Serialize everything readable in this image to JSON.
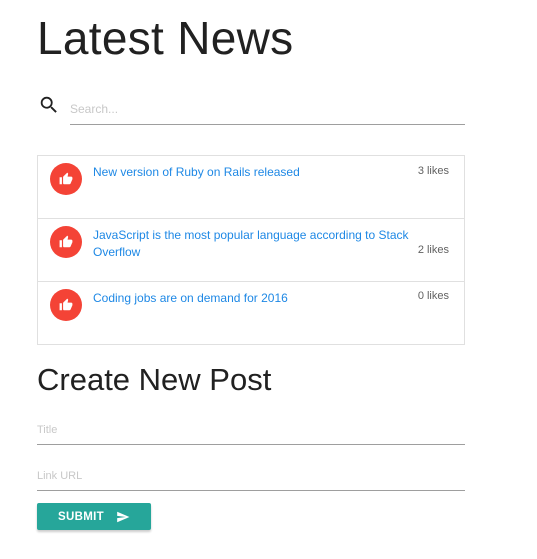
{
  "header": {
    "title": "Latest News"
  },
  "search": {
    "icon": "search-icon",
    "placeholder": "Search..."
  },
  "news": {
    "items": [
      {
        "title": "New version of Ruby on Rails released",
        "likes": "3 likes",
        "icon": "thumb-up-icon"
      },
      {
        "title": "JavaScript is the most popular language according to Stack Overflow",
        "likes": "2 likes",
        "icon": "thumb-up-icon"
      },
      {
        "title": "Coding jobs are on demand for 2016",
        "likes": "0 likes",
        "icon": "thumb-up-icon"
      }
    ]
  },
  "form": {
    "title": "Create New Post",
    "title_placeholder": "Title",
    "link_placeholder": "Link URL",
    "submit_label": "SUBMIT",
    "submit_icon": "send-icon"
  },
  "colors": {
    "like_button": "#f44336",
    "link": "#1e88e5",
    "submit_button": "#26a69a"
  }
}
